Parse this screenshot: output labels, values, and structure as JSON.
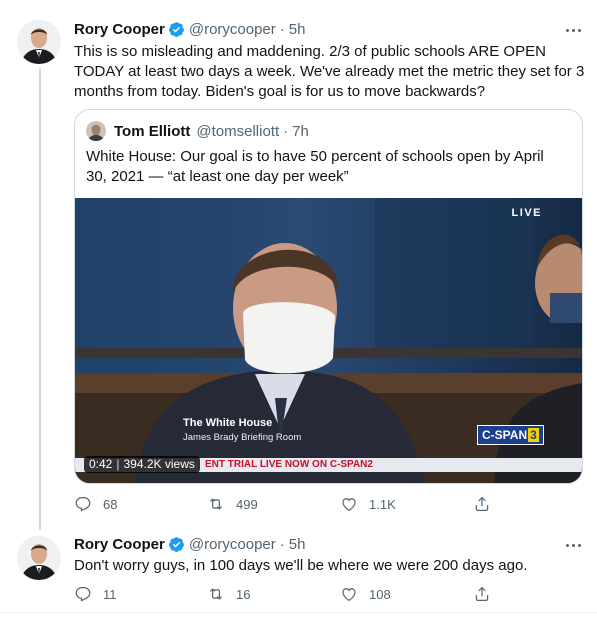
{
  "tweets": [
    {
      "name": "Rory Cooper",
      "handle": "@rorycooper",
      "time": "5h",
      "text": "This is so misleading and maddening. 2/3 of public schools ARE OPEN TODAY at least two days a week. We've already met the metric they set for 3 months from today. Biden's goal is for us to move backwards?",
      "quote": {
        "name": "Tom Elliott",
        "handle": "@tomselliott",
        "time": "7h",
        "text": "White House: Our goal is to have 50 percent of schools open by April 30, 2021 — “at least one day per week”",
        "video": {
          "live_label": "LIVE",
          "lower_third_title": "The White House",
          "lower_third_subtitle": "James Brady Briefing Room",
          "network": "C-SPAN",
          "network_number": "3",
          "ticker": "ENT TRIAL LIVE NOW ON C-SPAN2",
          "elapsed": "0:42",
          "views": "394.2K views"
        }
      },
      "replies": "68",
      "retweets": "499",
      "likes": "1.1K"
    },
    {
      "name": "Rory Cooper",
      "handle": "@rorycooper",
      "time": "5h",
      "text": "Don't worry guys, in 100 days we'll be where we were 200 days ago.",
      "replies": "11",
      "retweets": "16",
      "likes": "108"
    }
  ],
  "colors": {
    "text_primary": "#0f1419",
    "text_secondary": "#536471",
    "verified_blue": "#1d9bf0",
    "border": "#cfd9de"
  },
  "icons": [
    "verified-badge-icon",
    "more-icon",
    "reply-icon",
    "retweet-icon",
    "like-icon",
    "share-icon"
  ]
}
